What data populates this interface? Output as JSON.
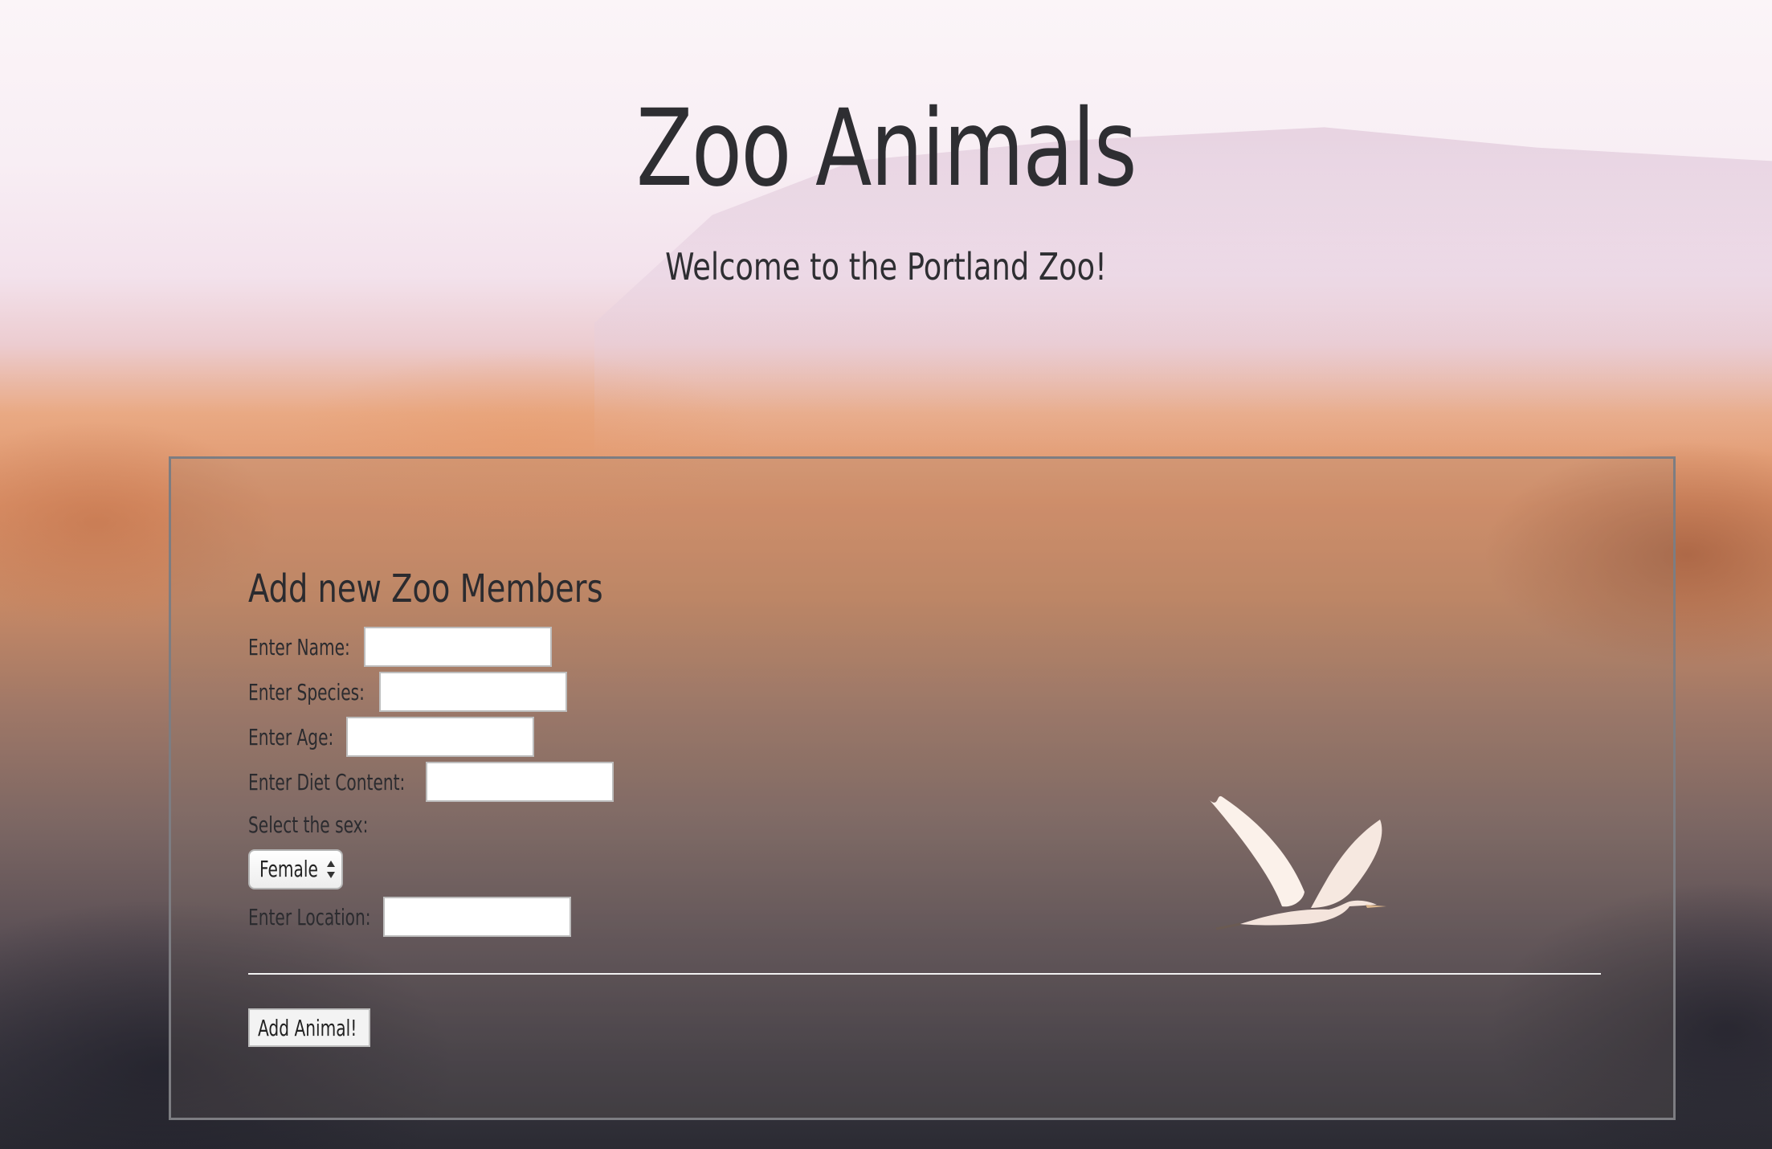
{
  "header": {
    "title": "Zoo Animals",
    "subtitle": "Welcome to the Portland Zoo!"
  },
  "form": {
    "heading": "Add new Zoo Members",
    "fields": {
      "name_label": "Enter Name:",
      "name_value": "",
      "species_label": "Enter Species:",
      "species_value": "",
      "age_label": "Enter Age:",
      "age_value": "",
      "diet_label": "Enter Diet Content:",
      "diet_value": "",
      "sex_label": "Select the sex:",
      "sex_selected": "Female",
      "location_label": "Enter Location:",
      "location_value": ""
    },
    "submit_label": "Add Animal!"
  },
  "colors": {
    "text": "#2e2e32",
    "panel_border": "#7d7d82",
    "divider": "#f2f2f2"
  },
  "icons": {
    "select_arrows": "updown-chevron-icon",
    "background_bird": "egret-bird-image"
  }
}
